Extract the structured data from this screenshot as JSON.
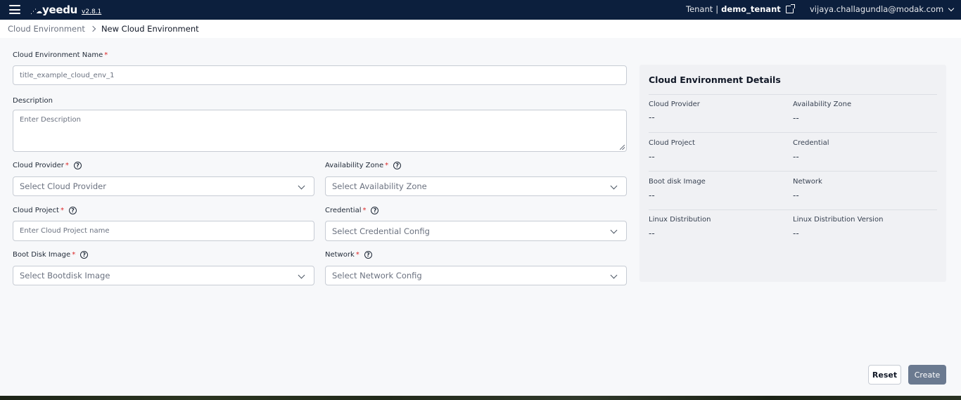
{
  "app": {
    "logo_mark": "⋰☁",
    "logo_text": "yeedu",
    "version": "v2.8.1"
  },
  "header": {
    "tenant_label": "Tenant",
    "tenant_sep": "|",
    "tenant_name": "demo_tenant",
    "user_email": "vijaya.challagundla@modak.com"
  },
  "breadcrumb": {
    "parent": "Cloud Environment",
    "current": "New Cloud Environment"
  },
  "form": {
    "name": {
      "label": "Cloud Environment Name",
      "required": "*",
      "placeholder": "title_example_cloud_env_1"
    },
    "description": {
      "label": "Description",
      "placeholder": "Enter Description"
    },
    "cloud_provider": {
      "label": "Cloud Provider",
      "required": "*",
      "help": "?",
      "value": "Select Cloud Provider"
    },
    "availability_zone": {
      "label": "Availability Zone",
      "required": "*",
      "help": "?",
      "value": "Select Availability Zone"
    },
    "cloud_project": {
      "label": "Cloud Project",
      "required": "*",
      "help": "?",
      "placeholder": "Enter Cloud Project name"
    },
    "credential": {
      "label": "Credential",
      "required": "*",
      "help": "?",
      "value": "Select Credential Config"
    },
    "boot_disk_image": {
      "label": "Boot Disk Image",
      "required": "*",
      "help": "?",
      "value": "Select Bootdisk Image"
    },
    "network": {
      "label": "Network",
      "required": "*",
      "help": "?",
      "value": "Select Network Config"
    }
  },
  "details": {
    "title": "Cloud Environment Details",
    "rows": [
      {
        "left_key": "Cloud Provider",
        "left_val": "--",
        "right_key": "Availability Zone",
        "right_val": "--"
      },
      {
        "left_key": "Cloud Project",
        "left_val": "--",
        "right_key": "Credential",
        "right_val": "--"
      },
      {
        "left_key": "Boot disk Image",
        "left_val": "--",
        "right_key": "Network",
        "right_val": "--"
      },
      {
        "left_key": "Linux Distribution",
        "left_val": "--",
        "right_key": "Linux Distribution Version",
        "right_val": "--"
      }
    ]
  },
  "actions": {
    "reset": "Reset",
    "create": "Create"
  },
  "colors": {
    "topbar": "#0c1f3d",
    "required": "#dc2626",
    "create_button": "#6b7a90"
  }
}
